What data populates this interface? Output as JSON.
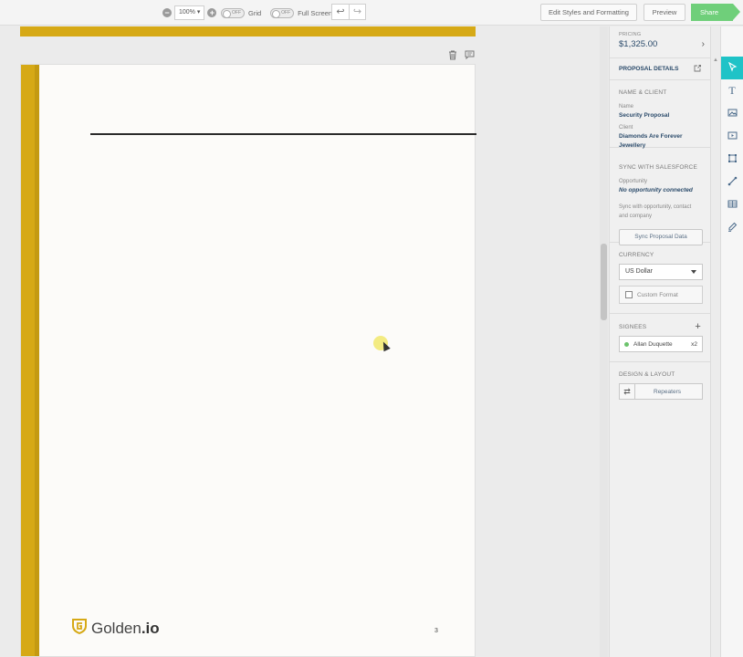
{
  "toolbar": {
    "zoom_value": "100%",
    "toggle_off_label": "OFF",
    "grid_label": "Grid",
    "fullscreen_label": "Full Screen",
    "undo_glyph": "↩",
    "redo_glyph": "↪",
    "edit_styles_label": "Edit Styles and Formatting",
    "preview_label": "Preview",
    "share_label": "Share"
  },
  "page": {
    "logo_text_regular": "Golden",
    "logo_text_bold": ".io",
    "page_number": "3"
  },
  "panel": {
    "pricing_label": "PRICING",
    "pricing_value": "$1,325.00",
    "details_title": "PROPOSAL DETAILS",
    "name_client_heading": "NAME & CLIENT",
    "name_label": "Name",
    "name_value": "Security Proposal",
    "client_label": "Client",
    "client_value": "Diamonds Are Forever Jewellery",
    "sync_heading": "SYNC WITH SALESFORCE",
    "opportunity_label": "Opportunity",
    "opportunity_value": "No opportunity connected",
    "sync_note": "Sync with opportunity, contact and company",
    "sync_button": "Sync Proposal Data",
    "currency_heading": "CURRENCY",
    "currency_value": "US Dollar",
    "custom_format_label": "Custom Format",
    "signees_heading": "SIGNEES",
    "signee_name": "Allan Duquette",
    "signee_count": "x2",
    "design_heading": "DESIGN & LAYOUT",
    "repeaters_label": "Repeaters"
  },
  "icons": [
    "zoom-out-icon",
    "zoom-in-icon",
    "undo-icon",
    "redo-icon",
    "trash-icon",
    "comment-icon",
    "external-edit-icon",
    "chevron-right-icon",
    "pointer-icon",
    "text-icon",
    "image-icon",
    "video-icon",
    "shape-icon",
    "line-icon",
    "table-icon",
    "signature-icon",
    "repeat-icon",
    "golden-logo-icon"
  ],
  "colors": {
    "brand_gold": "#d6a916",
    "accent_teal": "#1fc3c7",
    "share_green": "#6fcf7a",
    "link_blue": "#2a4a6a"
  }
}
